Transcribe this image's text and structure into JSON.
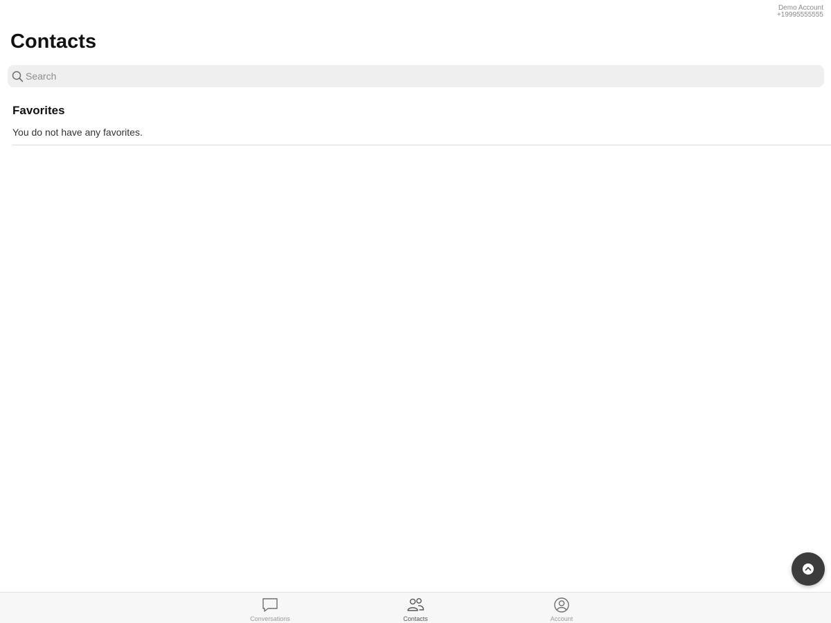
{
  "account": {
    "name": "Demo Account",
    "phone": "+19995555555"
  },
  "page": {
    "title": "Contacts"
  },
  "search": {
    "placeholder": "Search",
    "value": ""
  },
  "favorites": {
    "title": "Favorites",
    "empty_text": "You do not have any favorites."
  },
  "fab": {
    "icon": "chevron-up-icon"
  },
  "tabs": [
    {
      "label": "Conversations",
      "icon": "chat-bubble-icon",
      "active": false
    },
    {
      "label": "Contacts",
      "icon": "people-icon",
      "active": true
    },
    {
      "label": "Account",
      "icon": "person-circle-icon",
      "active": false
    }
  ],
  "colors": {
    "fab_background": "#3c3c3c",
    "search_background": "#efefef",
    "tab_bar_background": "#f7f7f7"
  }
}
